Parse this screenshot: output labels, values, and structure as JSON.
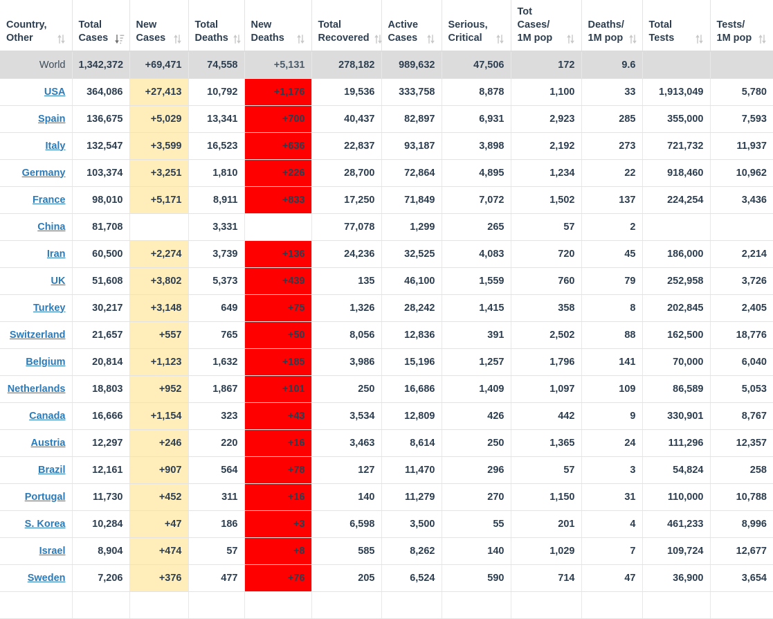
{
  "table": {
    "columns": [
      {
        "key": "country",
        "label": "Country,\nOther",
        "label_line1": "Country,",
        "label_line2": "Other",
        "sort": "none"
      },
      {
        "key": "totcases",
        "label": "Total Cases",
        "label_line1": "Total",
        "label_line2": "Cases",
        "sort": "desc"
      },
      {
        "key": "newcases",
        "label": "New Cases",
        "label_line1": "New",
        "label_line2": "Cases",
        "sort": "none"
      },
      {
        "key": "totdeaths",
        "label": "Total Deaths",
        "label_line1": "Total",
        "label_line2": "Deaths",
        "sort": "none"
      },
      {
        "key": "newdeaths",
        "label": "New Deaths",
        "label_line1": "New",
        "label_line2": "Deaths",
        "sort": "none"
      },
      {
        "key": "totrec",
        "label": "Total Recovered",
        "label_line1": "Total",
        "label_line2": "Recovered",
        "sort": "none"
      },
      {
        "key": "active",
        "label": "Active Cases",
        "label_line1": "Active",
        "label_line2": "Cases",
        "sort": "none"
      },
      {
        "key": "serious",
        "label": "Serious, Critical",
        "label_line1": "Serious,",
        "label_line2": "Critical",
        "sort": "none"
      },
      {
        "key": "casesm",
        "label": "Tot Cases/1M pop",
        "label_line1": "Tot Cases/",
        "label_line2": "1M pop",
        "sort": "none"
      },
      {
        "key": "deathsm",
        "label": "Deaths/1M pop",
        "label_line1": "Deaths/",
        "label_line2": "1M pop",
        "sort": "none"
      },
      {
        "key": "tottests",
        "label": "Total Tests",
        "label_line1": "Total",
        "label_line2": "Tests",
        "sort": "none"
      },
      {
        "key": "testsm",
        "label": "Tests/1M pop",
        "label_line1": "Tests/",
        "label_line2": "1M pop",
        "sort": "none"
      }
    ],
    "world_row": {
      "country": "World",
      "totcases": "1,342,372",
      "newcases": "+69,471",
      "totdeaths": "74,558",
      "newdeaths": "+5,131",
      "totrec": "278,182",
      "active": "989,632",
      "serious": "47,506",
      "casesm": "172",
      "deathsm": "9.6",
      "tottests": "",
      "testsm": ""
    },
    "rows": [
      {
        "country": "USA",
        "totcases": "364,086",
        "newcases": "+27,413",
        "totdeaths": "10,792",
        "newdeaths": "+1,176",
        "totrec": "19,536",
        "active": "333,758",
        "serious": "8,878",
        "casesm": "1,100",
        "deathsm": "33",
        "tottests": "1,913,049",
        "testsm": "5,780"
      },
      {
        "country": "Spain",
        "totcases": "136,675",
        "newcases": "+5,029",
        "totdeaths": "13,341",
        "newdeaths": "+700",
        "totrec": "40,437",
        "active": "82,897",
        "serious": "6,931",
        "casesm": "2,923",
        "deathsm": "285",
        "tottests": "355,000",
        "testsm": "7,593"
      },
      {
        "country": "Italy",
        "totcases": "132,547",
        "newcases": "+3,599",
        "totdeaths": "16,523",
        "newdeaths": "+636",
        "totrec": "22,837",
        "active": "93,187",
        "serious": "3,898",
        "casesm": "2,192",
        "deathsm": "273",
        "tottests": "721,732",
        "testsm": "11,937"
      },
      {
        "country": "Germany",
        "totcases": "103,374",
        "newcases": "+3,251",
        "totdeaths": "1,810",
        "newdeaths": "+226",
        "totrec": "28,700",
        "active": "72,864",
        "serious": "4,895",
        "casesm": "1,234",
        "deathsm": "22",
        "tottests": "918,460",
        "testsm": "10,962"
      },
      {
        "country": "France",
        "totcases": "98,010",
        "newcases": "+5,171",
        "totdeaths": "8,911",
        "newdeaths": "+833",
        "totrec": "17,250",
        "active": "71,849",
        "serious": "7,072",
        "casesm": "1,502",
        "deathsm": "137",
        "tottests": "224,254",
        "testsm": "3,436"
      },
      {
        "country": "China",
        "totcases": "81,708",
        "newcases": "",
        "totdeaths": "3,331",
        "newdeaths": "",
        "totrec": "77,078",
        "active": "1,299",
        "serious": "265",
        "casesm": "57",
        "deathsm": "2",
        "tottests": "",
        "testsm": ""
      },
      {
        "country": "Iran",
        "totcases": "60,500",
        "newcases": "+2,274",
        "totdeaths": "3,739",
        "newdeaths": "+136",
        "totrec": "24,236",
        "active": "32,525",
        "serious": "4,083",
        "casesm": "720",
        "deathsm": "45",
        "tottests": "186,000",
        "testsm": "2,214"
      },
      {
        "country": "UK",
        "totcases": "51,608",
        "newcases": "+3,802",
        "totdeaths": "5,373",
        "newdeaths": "+439",
        "totrec": "135",
        "active": "46,100",
        "serious": "1,559",
        "casesm": "760",
        "deathsm": "79",
        "tottests": "252,958",
        "testsm": "3,726"
      },
      {
        "country": "Turkey",
        "totcases": "30,217",
        "newcases": "+3,148",
        "totdeaths": "649",
        "newdeaths": "+75",
        "totrec": "1,326",
        "active": "28,242",
        "serious": "1,415",
        "casesm": "358",
        "deathsm": "8",
        "tottests": "202,845",
        "testsm": "2,405"
      },
      {
        "country": "Switzerland",
        "totcases": "21,657",
        "newcases": "+557",
        "totdeaths": "765",
        "newdeaths": "+50",
        "totrec": "8,056",
        "active": "12,836",
        "serious": "391",
        "casesm": "2,502",
        "deathsm": "88",
        "tottests": "162,500",
        "testsm": "18,776"
      },
      {
        "country": "Belgium",
        "totcases": "20,814",
        "newcases": "+1,123",
        "totdeaths": "1,632",
        "newdeaths": "+185",
        "totrec": "3,986",
        "active": "15,196",
        "serious": "1,257",
        "casesm": "1,796",
        "deathsm": "141",
        "tottests": "70,000",
        "testsm": "6,040"
      },
      {
        "country": "Netherlands",
        "totcases": "18,803",
        "newcases": "+952",
        "totdeaths": "1,867",
        "newdeaths": "+101",
        "totrec": "250",
        "active": "16,686",
        "serious": "1,409",
        "casesm": "1,097",
        "deathsm": "109",
        "tottests": "86,589",
        "testsm": "5,053"
      },
      {
        "country": "Canada",
        "totcases": "16,666",
        "newcases": "+1,154",
        "totdeaths": "323",
        "newdeaths": "+43",
        "totrec": "3,534",
        "active": "12,809",
        "serious": "426",
        "casesm": "442",
        "deathsm": "9",
        "tottests": "330,901",
        "testsm": "8,767"
      },
      {
        "country": "Austria",
        "totcases": "12,297",
        "newcases": "+246",
        "totdeaths": "220",
        "newdeaths": "+16",
        "totrec": "3,463",
        "active": "8,614",
        "serious": "250",
        "casesm": "1,365",
        "deathsm": "24",
        "tottests": "111,296",
        "testsm": "12,357"
      },
      {
        "country": "Brazil",
        "totcases": "12,161",
        "newcases": "+907",
        "totdeaths": "564",
        "newdeaths": "+78",
        "totrec": "127",
        "active": "11,470",
        "serious": "296",
        "casesm": "57",
        "deathsm": "3",
        "tottests": "54,824",
        "testsm": "258"
      },
      {
        "country": "Portugal",
        "totcases": "11,730",
        "newcases": "+452",
        "totdeaths": "311",
        "newdeaths": "+16",
        "totrec": "140",
        "active": "11,279",
        "serious": "270",
        "casesm": "1,150",
        "deathsm": "31",
        "tottests": "110,000",
        "testsm": "10,788"
      },
      {
        "country": "S. Korea",
        "totcases": "10,284",
        "newcases": "+47",
        "totdeaths": "186",
        "newdeaths": "+3",
        "totrec": "6,598",
        "active": "3,500",
        "serious": "55",
        "casesm": "201",
        "deathsm": "4",
        "tottests": "461,233",
        "testsm": "8,996"
      },
      {
        "country": "Israel",
        "totcases": "8,904",
        "newcases": "+474",
        "totdeaths": "57",
        "newdeaths": "+8",
        "totrec": "585",
        "active": "8,262",
        "serious": "140",
        "casesm": "1,029",
        "deathsm": "7",
        "tottests": "109,724",
        "testsm": "12,677"
      },
      {
        "country": "Sweden",
        "totcases": "7,206",
        "newcases": "+376",
        "totdeaths": "477",
        "newdeaths": "+76",
        "totrec": "205",
        "active": "6,524",
        "serious": "590",
        "casesm": "714",
        "deathsm": "47",
        "tottests": "36,900",
        "testsm": "3,654"
      },
      {
        "country": "",
        "totcases": "",
        "newcases": "",
        "totdeaths": "",
        "newdeaths": "",
        "totrec": "",
        "active": "",
        "serious": "",
        "casesm": "",
        "deathsm": "",
        "tottests": "",
        "testsm": ""
      }
    ]
  },
  "colors": {
    "new_cases_highlight": "#ffeeba",
    "new_deaths_highlight": "#ff0000",
    "world_row_background": "#dcdcdc",
    "link": "#2b7bba",
    "text": "#2c3e50"
  },
  "icons": {
    "sort_neutral": "sort-icon",
    "sort_descending": "sort-amount-desc-icon"
  }
}
